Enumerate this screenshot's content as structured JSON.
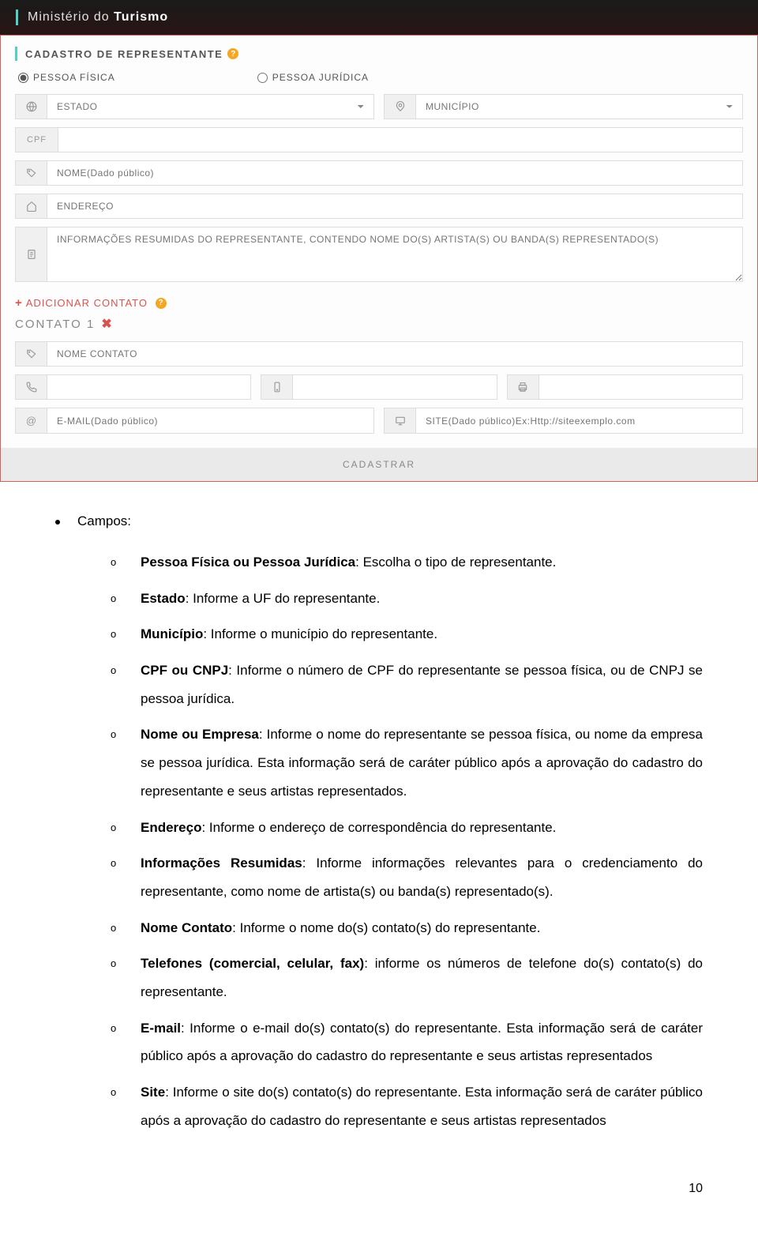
{
  "header": {
    "prefix": "Ministério do ",
    "bold": "Turismo"
  },
  "form": {
    "section_title": "CADASTRO DE REPRESENTANTE",
    "radio_fisica": "PESSOA FÍSICA",
    "radio_juridica": "PESSOA JURÍDICA",
    "estado_placeholder": "ESTADO",
    "municipio_placeholder": "MUNICÍPIO",
    "cpf_label": "CPF",
    "nome_placeholder": "NOME(Dado público)",
    "endereco_placeholder": "ENDEREÇO",
    "info_placeholder": "INFORMAÇÕES RESUMIDAS DO REPRESENTANTE, CONTENDO NOME DO(S) ARTISTA(S) OU BANDA(S) REPRESENTADO(S)",
    "add_contact": "ADICIONAR CONTATO",
    "contact_header": "CONTATO 1",
    "nome_contato_placeholder": "NOME CONTATO",
    "email_placeholder": "E-MAIL(Dado público)",
    "site_placeholder": "SITE(Dado público)Ex:Http://siteexemplo.com",
    "submit": "CADASTRAR"
  },
  "doc": {
    "campos_label": "Campos:",
    "items": [
      {
        "b": "Pessoa Física ou Pessoa Jurídica",
        "t": ": Escolha o tipo de representante."
      },
      {
        "b": "Estado",
        "t": ": Informe a UF do representante."
      },
      {
        "b": "Município",
        "t": ": Informe o município do representante."
      },
      {
        "b": "CPF ou CNPJ",
        "t": ": Informe o número de CPF do representante se pessoa física, ou de CNPJ se pessoa jurídica."
      },
      {
        "b": "Nome ou Empresa",
        "t": ": Informe o nome do representante se pessoa física, ou nome da empresa se pessoa jurídica. Esta informação será de caráter público após a aprovação do cadastro do representante e seus artistas representados."
      },
      {
        "b": "Endereço",
        "t": ": Informe o endereço de correspondência do representante."
      },
      {
        "b": "Informações Resumidas",
        "t": ": Informe informações relevantes para o credenciamento do representante, como nome de artista(s) ou banda(s) representado(s)."
      },
      {
        "b": "Nome Contato",
        "t": ": Informe o nome do(s) contato(s) do representante."
      },
      {
        "b": "Telefones (comercial, celular, fax)",
        "t": ": informe os números de telefone do(s) contato(s) do representante."
      },
      {
        "b": "E-mail",
        "t": ": Informe o e-mail do(s) contato(s) do representante. Esta informação será de caráter público após a aprovação do cadastro do representante e seus artistas representados"
      },
      {
        "b": "Site",
        "t": ": Informe o site do(s) contato(s) do representante. Esta informação será de caráter público após a aprovação do cadastro do representante e seus artistas representados"
      }
    ],
    "page_num": "10"
  }
}
